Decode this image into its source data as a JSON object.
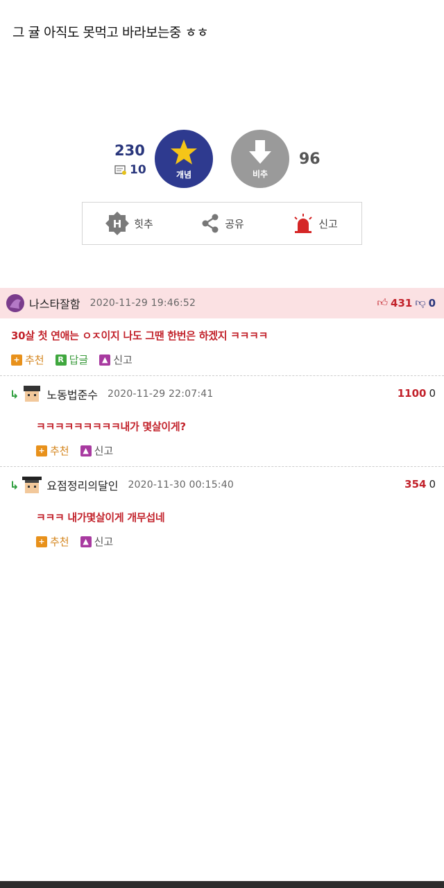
{
  "post": {
    "body": "그 귤 아직도 못먹고 바라보는중 ㅎㅎ"
  },
  "vote": {
    "up_count": "230",
    "gonic_count": "10",
    "up_label": "개념",
    "down_label": "비추",
    "down_count": "96",
    "colors": {
      "up": "#2e3a8f",
      "down": "#9a9a9a"
    }
  },
  "actions": {
    "hit": "힛추",
    "share": "공유",
    "report": "신고"
  },
  "comments": [
    {
      "nick": "나스타잘함",
      "date": "2020-11-29 19:46:52",
      "likes": "431",
      "dislikes": "0",
      "text": "30살 첫 연애는 ㅇㅈ이지 나도 그땐 한번은 하겠지 ㅋㅋㅋㅋ",
      "recommend": "추천",
      "reply": "답글",
      "report": "신고"
    },
    {
      "nick": "노동법준수",
      "date": "2020-11-29 22:07:41",
      "likes": "1100",
      "dislikes": "0",
      "text": "ㅋㅋㅋㅋㅋㅋㅋㅋㅋ내가 몇살이게?",
      "recommend": "추천",
      "report": "신고"
    },
    {
      "nick": "요점정리의달인",
      "date": "2020-11-30 00:15:40",
      "likes": "354",
      "dislikes": "0",
      "text": "ㅋㅋㅋ 내가몇살이게 개무섭네",
      "recommend": "추천",
      "report": "신고"
    }
  ]
}
